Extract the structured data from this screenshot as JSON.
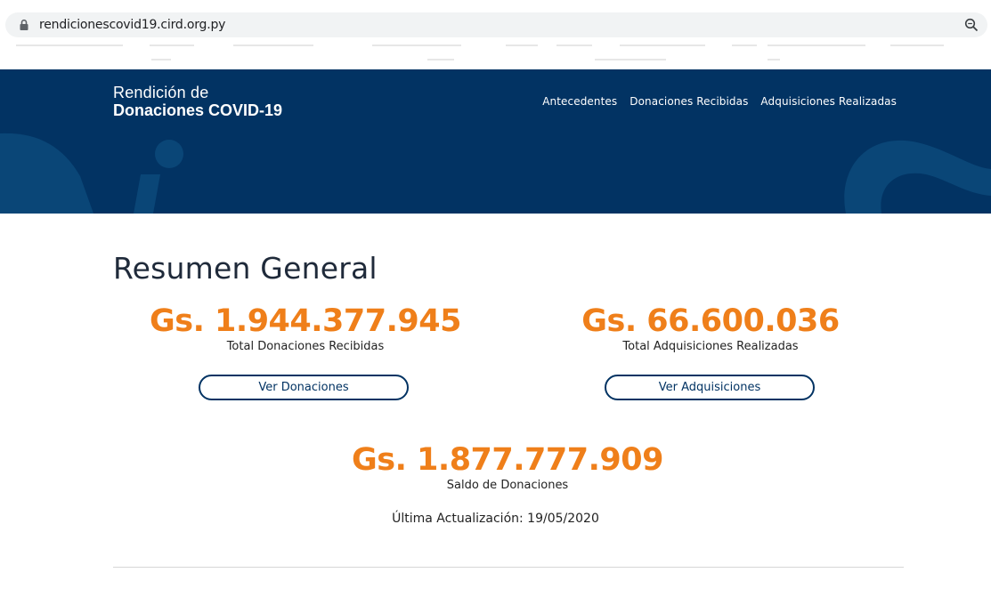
{
  "browser": {
    "url": "rendicionescovid19.cird.org.py",
    "icons": [
      "lock-icon",
      "zoom-icon"
    ]
  },
  "header": {
    "brand_line1": "Rendición de",
    "brand_line2": "Donaciones COVID-19",
    "nav": [
      "Antecedentes",
      "Donaciones Recibidas",
      "Adquisiciones Realizadas"
    ]
  },
  "main": {
    "title": "Resumen General",
    "donations": {
      "amount": "Gs. 1.944.377.945",
      "caption": "Total Donaciones Recibidas",
      "button": "Ver Donaciones"
    },
    "acquisitions": {
      "amount": "Gs. 66.600.036",
      "caption": "Total Adquisiciones Realizadas",
      "button": "Ver Adquisiciones"
    },
    "balance": {
      "amount": "Gs. 1.877.777.909",
      "caption": "Saldo de Donaciones"
    },
    "updated": "Última Actualización: 19/05/2020"
  },
  "colors": {
    "header_bg": "#023363",
    "accent": "#ef7f1a",
    "button_border": "#023363"
  }
}
